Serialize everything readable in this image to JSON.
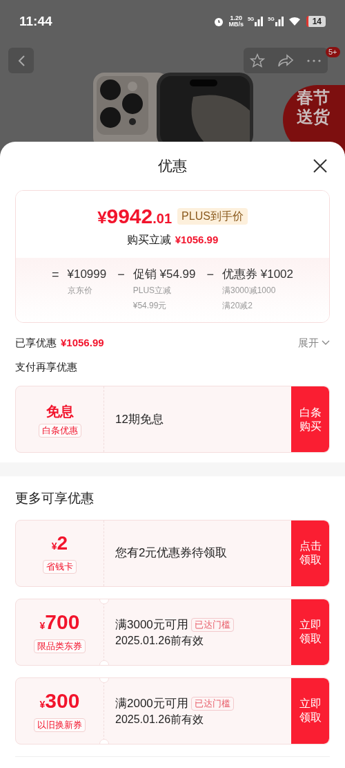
{
  "status_bar": {
    "time": "11:44",
    "speed_value": "1.20",
    "speed_unit": "MB/s",
    "signals": [
      "5G",
      "5G"
    ],
    "battery": "14"
  },
  "page": {
    "badge": "5+",
    "promo": [
      "春节",
      "送货"
    ]
  },
  "sheet": {
    "title": "优惠",
    "summary": {
      "currency": "¥",
      "integer": "9942",
      "decimal": ".01",
      "tag": "PLUS到手价",
      "reduction_label": "购买立减",
      "reduction_value": "¥1056.99",
      "breakdown": [
        {
          "operator": "=",
          "amount": "¥10999",
          "notes": [
            "京东价"
          ]
        },
        {
          "operator": "−",
          "label": "促销",
          "amount": "¥54.99",
          "notes": [
            "PLUS立减",
            "¥54.99元"
          ]
        },
        {
          "operator": "−",
          "label": "优惠券",
          "amount": "¥1002",
          "notes": [
            "满3000减1000",
            "满20减2"
          ]
        }
      ]
    },
    "enjoyed": {
      "label": "已享优惠",
      "value": "¥1056.99",
      "toggle": "展开",
      "expanded": false
    },
    "payment_title": "支付再享优惠",
    "payment_offers": [
      {
        "kind": "text",
        "headline": "免息",
        "tag": "白条优惠",
        "description": "12期免息",
        "action": [
          "白条",
          "购买"
        ]
      }
    ],
    "more_title": "更多可享优惠",
    "coupons": [
      {
        "kind": "card",
        "currency": "¥",
        "amount": "2",
        "tag": "省钱卡",
        "description": "您有2元优惠券待领取",
        "action": [
          "点击",
          "领取"
        ]
      },
      {
        "kind": "ticket",
        "currency": "¥",
        "amount": "700",
        "tag": "限品类东券",
        "description": "满3000元可用",
        "badge": "已达门槛",
        "validity": "2025.01.26前有效",
        "action": [
          "立即",
          "领取"
        ]
      },
      {
        "kind": "ticket",
        "currency": "¥",
        "amount": "300",
        "tag": "以旧换新券",
        "description": "满2000元可用",
        "badge": "已达门槛",
        "validity": "2025.01.26前有效",
        "action": [
          "立即",
          "领取"
        ]
      }
    ]
  }
}
